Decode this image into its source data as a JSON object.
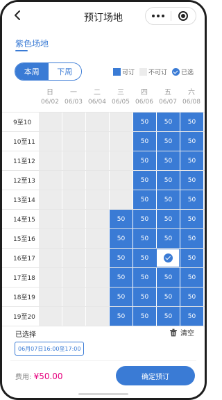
{
  "nav": {
    "title": "预订场地"
  },
  "venue_tab": "紫色场地",
  "week_switch": {
    "this_week": "本周",
    "next_week": "下周"
  },
  "legend": {
    "available": "可订",
    "unavailable": "不可订",
    "selected": "已选"
  },
  "days": [
    {
      "name": "日",
      "date": "06/02"
    },
    {
      "name": "一",
      "date": "06/03"
    },
    {
      "name": "二",
      "date": "06/04"
    },
    {
      "name": "三",
      "date": "06/05"
    },
    {
      "name": "四",
      "date": "06/06"
    },
    {
      "name": "五",
      "date": "06/07"
    },
    {
      "name": "六",
      "date": "06/08"
    }
  ],
  "rows": [
    {
      "time": "9至10",
      "cells": [
        "na",
        "na",
        "na",
        "na",
        "50",
        "50",
        "50"
      ]
    },
    {
      "time": "10至11",
      "cells": [
        "na",
        "na",
        "na",
        "na",
        "50",
        "50",
        "50"
      ]
    },
    {
      "time": "11至12",
      "cells": [
        "na",
        "na",
        "na",
        "na",
        "50",
        "50",
        "50"
      ]
    },
    {
      "time": "12至13",
      "cells": [
        "na",
        "na",
        "na",
        "na",
        "50",
        "50",
        "50"
      ]
    },
    {
      "time": "13至14",
      "cells": [
        "na",
        "na",
        "na",
        "na",
        "50",
        "50",
        "50"
      ]
    },
    {
      "time": "14至15",
      "cells": [
        "na",
        "na",
        "na",
        "50",
        "50",
        "50",
        "50"
      ]
    },
    {
      "time": "15至16",
      "cells": [
        "na",
        "na",
        "na",
        "50",
        "50",
        "50",
        "50"
      ]
    },
    {
      "time": "16至17",
      "cells": [
        "na",
        "na",
        "na",
        "50",
        "50",
        "sel",
        "50"
      ]
    },
    {
      "time": "17至18",
      "cells": [
        "na",
        "na",
        "na",
        "50",
        "50",
        "50",
        "50"
      ]
    },
    {
      "time": "18至19",
      "cells": [
        "na",
        "na",
        "na",
        "50",
        "50",
        "50",
        "50"
      ]
    },
    {
      "time": "19至20",
      "cells": [
        "na",
        "na",
        "na",
        "50",
        "50",
        "50",
        "50"
      ]
    }
  ],
  "selected": {
    "label": "已选择",
    "clear_label": "清空",
    "slots": [
      "06月07日16:00至17:00"
    ]
  },
  "footer": {
    "fee_label": "费用:",
    "fee_amount": "¥50.00",
    "confirm_label": "确定预订"
  },
  "colors": {
    "accent": "#3a7bd5",
    "unavailable": "#ececec",
    "price": "#e6007e"
  }
}
